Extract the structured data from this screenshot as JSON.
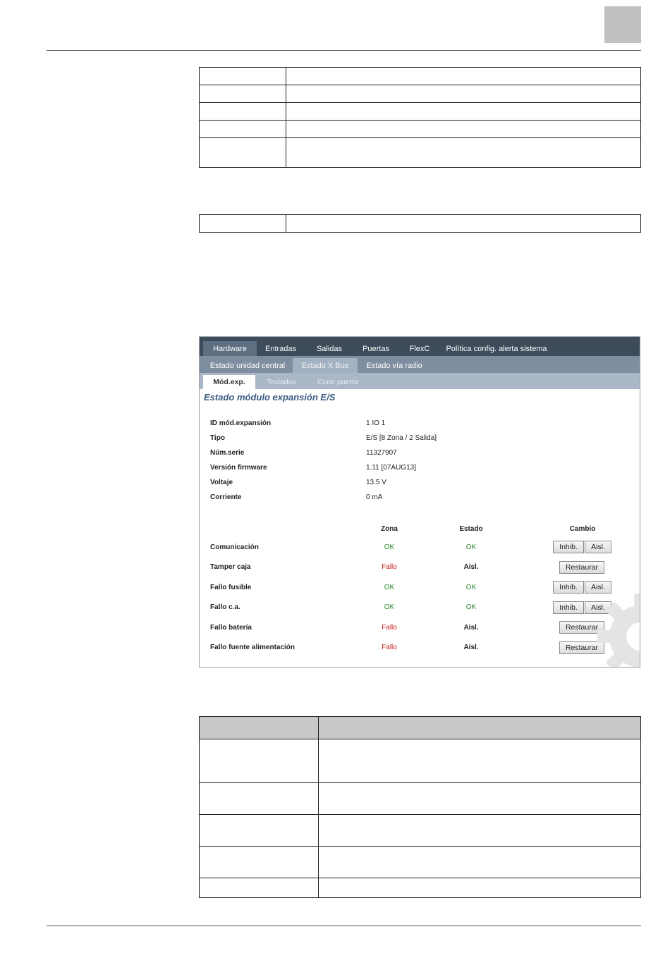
{
  "page": {
    "accent_gray": "#c0c0c0"
  },
  "ui": {
    "tabs_main": [
      {
        "label": "Hardware"
      },
      {
        "label": "Entradas"
      },
      {
        "label": "Salidas"
      },
      {
        "label": "Puertas"
      },
      {
        "label": "FlexC"
      },
      {
        "label": "Política config. alerta sistema"
      }
    ],
    "tabs_sub": [
      {
        "label": "Estado unidad central"
      },
      {
        "label": "Estado X Bus"
      },
      {
        "label": "Estado vía radio"
      }
    ],
    "tabs_third": [
      {
        "label": "Mód.exp."
      },
      {
        "label": "Teclados"
      },
      {
        "label": "Contr.puerta"
      }
    ],
    "title": "Estado módulo expansión E/S",
    "info": [
      {
        "label": "ID mód.expansión",
        "value": "1 IO 1"
      },
      {
        "label": "Tipo",
        "value": "E/S [8 Zona / 2 Salida]"
      },
      {
        "label": "Núm.serie",
        "value": "11327907"
      },
      {
        "label": "Versión firmware",
        "value": "1.11 [07AUG13]"
      },
      {
        "label": "Voltaje",
        "value": "13.5 V"
      },
      {
        "label": "Corriente",
        "value": "0 mA"
      }
    ],
    "headers": {
      "zona": "Zona",
      "estado": "Estado",
      "cambio": "Cambio"
    },
    "rows": [
      {
        "label": "Comunicación",
        "zona": "OK",
        "estado": "OK",
        "btn1": "Inhib.",
        "btn2": "Aisl."
      },
      {
        "label": "Tamper caja",
        "zona": "Fallo",
        "estado": "Aisl.",
        "btn1": "Restaurar"
      },
      {
        "label": "Fallo fusible",
        "zona": "OK",
        "estado": "OK",
        "btn1": "Inhib.",
        "btn2": "Aisl."
      },
      {
        "label": "Fallo c.a.",
        "zona": "OK",
        "estado": "OK",
        "btn1": "Inhib.",
        "btn2": "Aisl."
      },
      {
        "label": "Fallo batería",
        "zona": "Fallo",
        "estado": "Aisl.",
        "btn1": "Restaurar"
      },
      {
        "label": "Fallo fuente alimentación",
        "zona": "Fallo",
        "estado": "Aisl.",
        "btn1": "Restaurar"
      }
    ],
    "colors": {
      "nav_dark": "#3e4b5a",
      "nav_mid": "#7e8ea0",
      "nav_light": "#a9b7c6",
      "ok": "#2d8a2d",
      "fail": "#c62020",
      "title": "#3b5b82"
    }
  }
}
